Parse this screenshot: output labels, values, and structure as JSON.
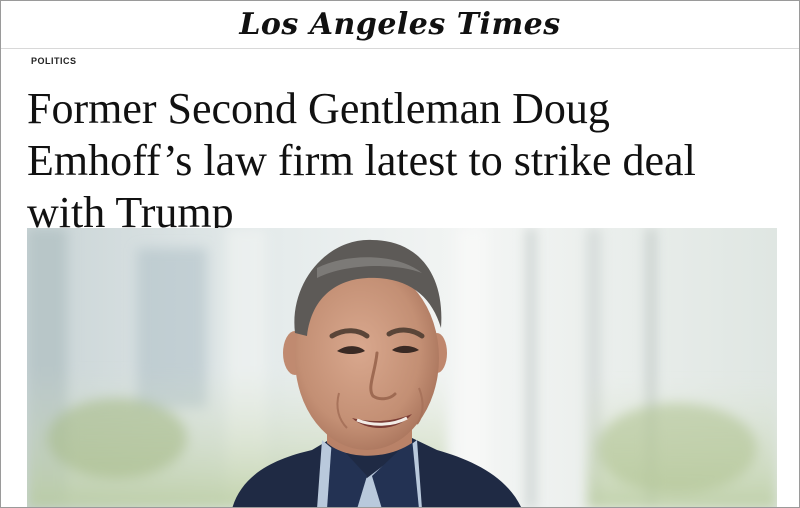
{
  "masthead": {
    "logo_text": "Los Angeles Times"
  },
  "article": {
    "section": "POLITICS",
    "headline": "Former Second Gentleman Doug Emhoff’s law firm latest to strike deal with Trump"
  },
  "hero_image": {
    "subject": "man-in-suit-photo"
  }
}
